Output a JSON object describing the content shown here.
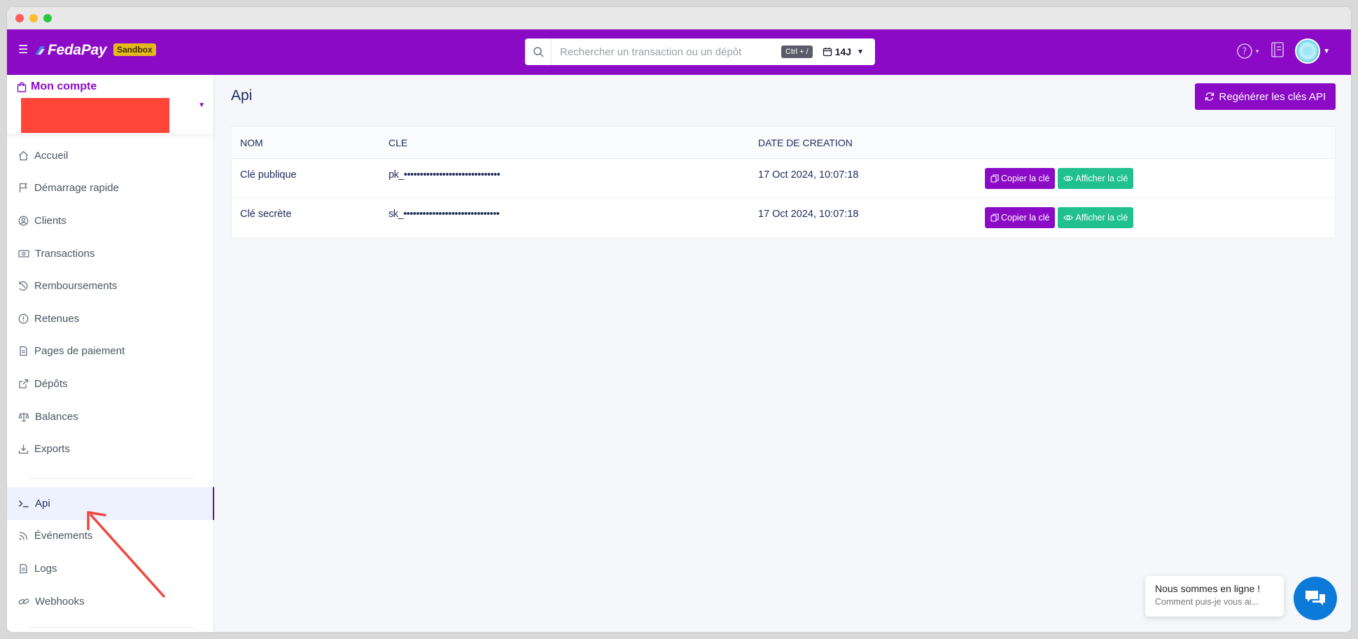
{
  "topbar": {
    "menu_icon": "hamburger-icon",
    "logo_text": "FedaPay",
    "env_badge": "Sandbox",
    "search_placeholder": "Rechercher un transaction ou un dépôt",
    "search_shortcut": "Ctrl + /",
    "date_range": "14J",
    "brand_color": "#8a0ac6"
  },
  "sidebar": {
    "account_title": "Mon compte",
    "items": [
      {
        "label": "Accueil",
        "icon": "home-icon"
      },
      {
        "label": "Démarrage rapide",
        "icon": "flag-icon"
      },
      {
        "label": "Clients",
        "icon": "user-circle-icon"
      },
      {
        "label": "Transactions",
        "icon": "money-icon"
      },
      {
        "label": "Remboursements",
        "icon": "refund-icon"
      },
      {
        "label": "Retenues",
        "icon": "alert-circle-icon"
      },
      {
        "label": "Pages de paiement",
        "icon": "document-icon"
      },
      {
        "label": "Dépôts",
        "icon": "external-link-icon"
      },
      {
        "label": "Balances",
        "icon": "scale-icon"
      },
      {
        "label": "Exports",
        "icon": "download-icon"
      }
    ],
    "dev_items": [
      {
        "label": "Api",
        "icon": "terminal-icon",
        "active": true
      },
      {
        "label": "Événements",
        "icon": "rss-icon"
      },
      {
        "label": "Logs",
        "icon": "file-icon"
      },
      {
        "label": "Webhooks",
        "icon": "link-icon"
      }
    ]
  },
  "main": {
    "title": "Api",
    "regenerate_label": "Regénérer les clés API",
    "table": {
      "headers": [
        "NOM",
        "CLE",
        "DATE DE CREATION"
      ],
      "rows": [
        {
          "name": "Clé publique",
          "key": "pk_••••••••••••••••••••••••••••••",
          "created": "17 Oct 2024, 10:07:18",
          "copy_label": "Copier la clé",
          "show_label": "Afficher la clé"
        },
        {
          "name": "Clé secrète",
          "key": "sk_••••••••••••••••••••••••••••••",
          "created": "17 Oct 2024, 10:07:18",
          "copy_label": "Copier la clé",
          "show_label": "Afficher la clé"
        }
      ]
    }
  },
  "chat": {
    "line1": "Nous sommes en ligne !",
    "line2": "Comment puis-je vous ai..."
  }
}
